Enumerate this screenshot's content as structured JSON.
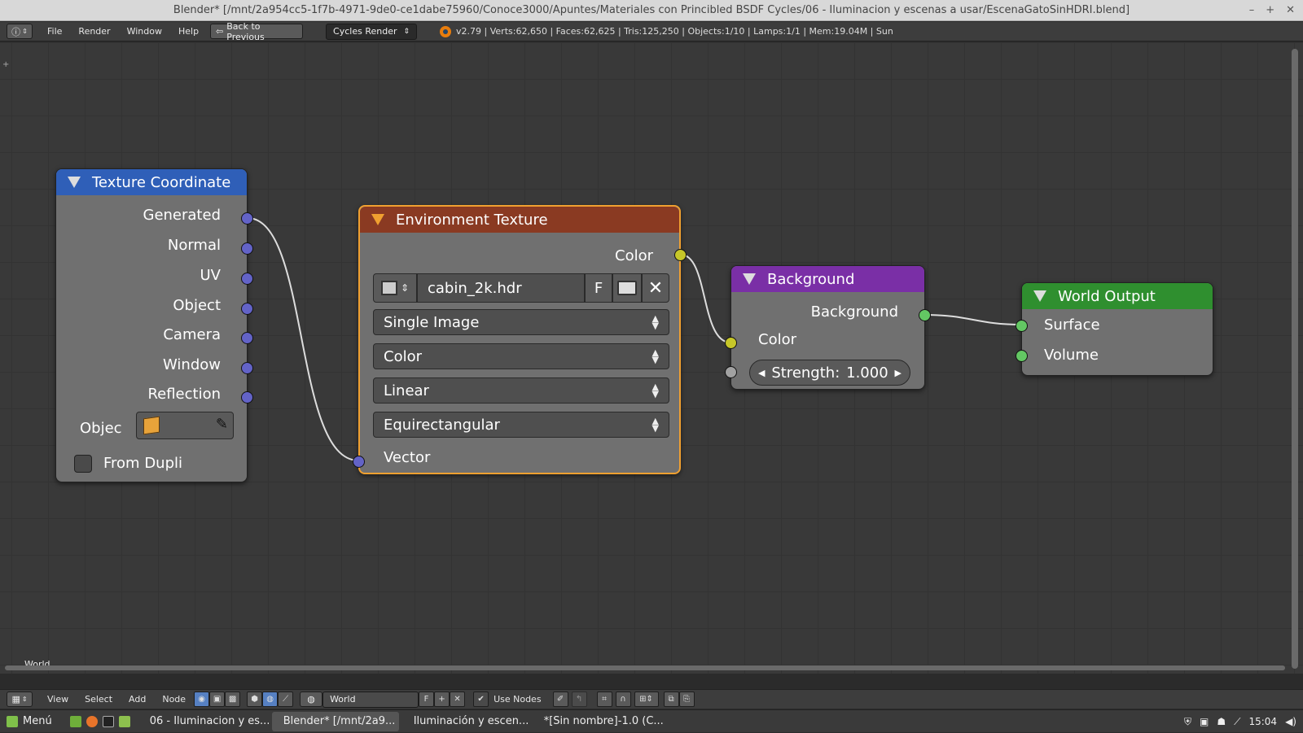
{
  "window": {
    "title": "Blender* [/mnt/2a954cc5-1f7b-4971-9de0-ce1dabe75960/Conoce3000/Apuntes/Materiales con Princibled BSDF Cycles/06 - Iluminacion y escenas a usar/EscenaGatoSinHDRI.blend]",
    "controls": [
      "–",
      "+",
      "✕"
    ]
  },
  "info_header": {
    "menus": [
      "File",
      "Render",
      "Window",
      "Help"
    ],
    "back_button": "Back to Previous",
    "render_engine": "Cycles Render",
    "stats": "v2.79 | Verts:62,650 | Faces:62,625 | Tris:125,250 | Objects:1/10 | Lamps:1/1 | Mem:19.04M | Sun"
  },
  "editor_label": "World",
  "nodes": {
    "texture_coordinate": {
      "title": "Texture Coordinate",
      "outputs": [
        "Generated",
        "Normal",
        "UV",
        "Object",
        "Camera",
        "Window",
        "Reflection"
      ],
      "object_label": "Objec",
      "from_dupli": "From Dupli"
    },
    "environment_texture": {
      "title": "Environment Texture",
      "output_color": "Color",
      "image_name": "cabin_2k.hdr",
      "fake_user": "F",
      "source": "Single Image",
      "color_space": "Color",
      "interpolation": "Linear",
      "projection": "Equirectangular",
      "input_vector": "Vector"
    },
    "background": {
      "title": "Background",
      "output": "Background",
      "input_color": "Color",
      "strength_label": "Strength:",
      "strength_value": "1.000"
    },
    "world_output": {
      "title": "World Output",
      "inputs": [
        "Surface",
        "Volume"
      ]
    }
  },
  "bottom_header": {
    "menus": [
      "View",
      "Select",
      "Add",
      "Node"
    ],
    "datablock": "World",
    "fake_user": "F",
    "use_nodes_label": "Use Nodes",
    "use_nodes_checked": true
  },
  "taskbar": {
    "menu_label": "Menú",
    "tasks": [
      "06 - Iluminacion y es...",
      "Blender* [/mnt/2a9...",
      "Iluminación y escen...",
      "*[Sin nombre]-1.0 (C..."
    ],
    "clock": "15:04"
  },
  "colors": {
    "tex_coord_header": "#2f5fb8",
    "env_tex_header": "#8a3a22",
    "background_header": "#7a2fa6",
    "world_output_header": "#2f8f2f",
    "selected_outline": "#f0a030"
  }
}
